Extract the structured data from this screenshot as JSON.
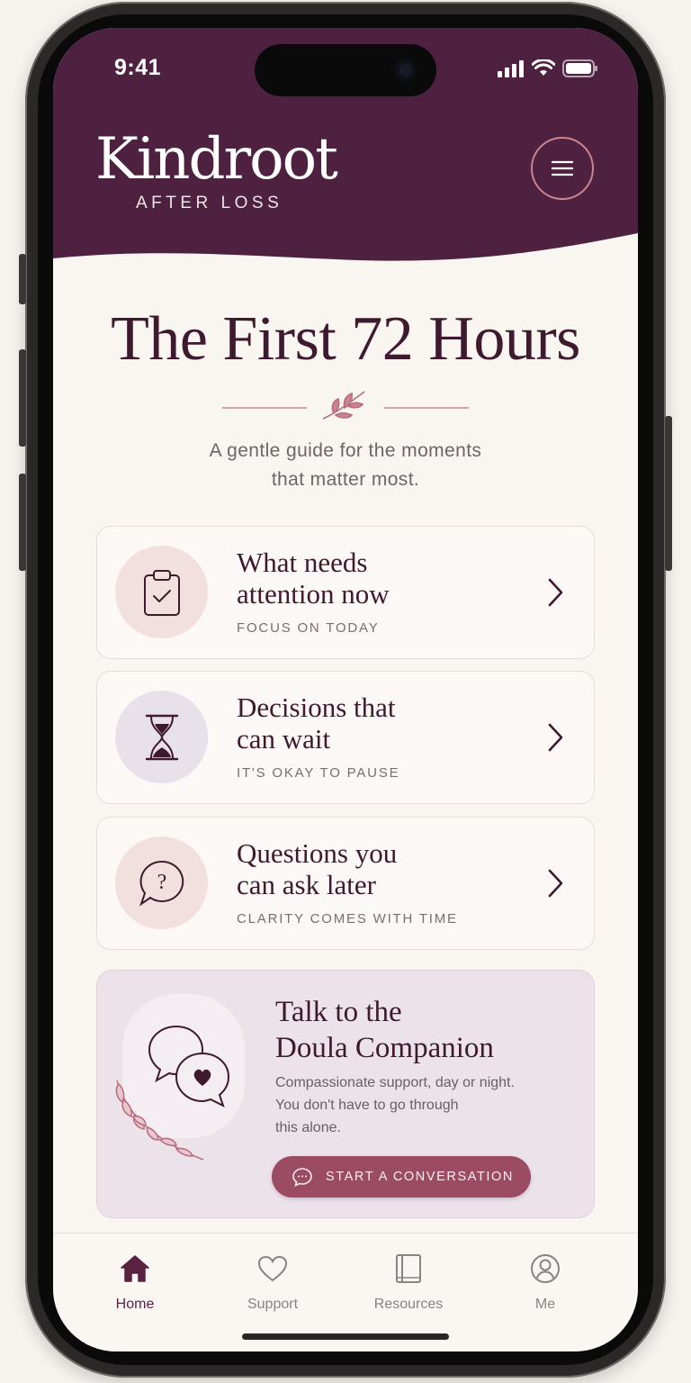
{
  "status": {
    "time": "9:41"
  },
  "brand": {
    "name": "Kindroot",
    "tagline": "AFTER LOSS"
  },
  "page": {
    "title": "The First 72 Hours",
    "subtitle_line1": "A gentle guide for the moments",
    "subtitle_line2": "that matter most."
  },
  "cards": [
    {
      "title_line1": "What needs",
      "title_line2": "attention now",
      "subtitle": "FOCUS ON TODAY",
      "icon": "clipboard-check-icon",
      "circle_color": "#f1e0dd"
    },
    {
      "title_line1": "Decisions that",
      "title_line2": "can wait",
      "subtitle": "IT'S OKAY TO PAUSE",
      "icon": "hourglass-icon",
      "circle_color": "#e9e1e9"
    },
    {
      "title_line1": "Questions you",
      "title_line2": "can ask later",
      "subtitle": "CLARITY COMES WITH TIME",
      "icon": "question-bubble-icon",
      "circle_color": "#f1e0dd"
    }
  ],
  "doula": {
    "title_line1": "Talk to the",
    "title_line2": "Doula Companion",
    "desc_line1": "Compassionate support, day or night.",
    "desc_line2": "You don't have to go through",
    "desc_line3": "this alone.",
    "cta_label": "START A CONVERSATION"
  },
  "tabs": [
    {
      "label": "Home",
      "icon": "home-icon",
      "active": true
    },
    {
      "label": "Support",
      "icon": "heart-icon",
      "active": false
    },
    {
      "label": "Resources",
      "icon": "book-icon",
      "active": false
    },
    {
      "label": "Me",
      "icon": "user-icon",
      "active": false
    }
  ],
  "colors": {
    "header": "#4f2140",
    "accent": "#9b4c63",
    "text": "#3f1a2f"
  }
}
